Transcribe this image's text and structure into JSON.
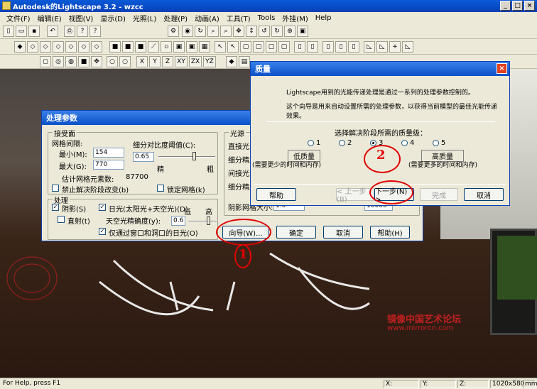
{
  "app": {
    "title": "Autodesk的Lightscape 3.2 - wzcc"
  },
  "menu": [
    "文件(F)",
    "编辑(E)",
    "视图(V)",
    "显示(D)",
    "光照(L)",
    "处理(P)",
    "动画(A)",
    "工具(T)",
    "Tools",
    "外挂(M)",
    "Help"
  ],
  "status": {
    "help": "For Help, press F1",
    "x": "X:",
    "y": "Y:",
    "z": "Z:",
    "size": "1020x580",
    "unit": "mm"
  },
  "toolbar3": {
    "x": "X",
    "y": "Y",
    "z": "Z",
    "xy": "XY",
    "zx": "ZX",
    "yz": "YZ"
  },
  "proc": {
    "title": "处理参数",
    "receiver_group": "接受面",
    "mesh_spacing": "网格间隔:",
    "min_label": "最小(M):",
    "min_value": "154",
    "max_label": "最大(G):",
    "max_value": "770",
    "contrast_label": "细分对比度阈值(C):",
    "contrast_value": "0.65",
    "fine": "精",
    "coarse": "粗",
    "est_label": "估计网格元素数:",
    "est_value": "87700",
    "disable_sub": "禁止解决阶段改变(b)",
    "lock_mesh": "锁定网格(k)",
    "process_group": "处理",
    "shadow": "阴影(S)",
    "daylight": "日光(太阳光+天空光)(D)",
    "direct": "直射(t)",
    "sky_acc": "天空光精确度(y):",
    "sky_value": "0.6",
    "low": "低",
    "high": "高",
    "windows_only": "仅通过窗口和洞口的日光(O)",
    "light_group": "光源",
    "light1": "直接光源",
    "light2": "细分精度",
    "light3": "间接光源",
    "light4": "细分精度",
    "shadow_mesh": "阴影网格大小:",
    "shadow_mesh_val": "1.0",
    "extra_val": "10000",
    "wizard_btn": "向导(W)...",
    "ok_btn": "确定",
    "cancel_btn": "取消",
    "help_btn": "帮助(H)"
  },
  "qual": {
    "title": "质量",
    "desc1": "Lightscape用到的光能传递处理是通过一系列的处理参数控制的。",
    "desc2": "这个向导是用来自动设置所需的处理参数，以获得当前模型的最佳光能传递效果。",
    "select": "选择解决阶段所需的质量级：",
    "levels": [
      "1",
      "2",
      "3",
      "4",
      "5"
    ],
    "low_label": "低质量",
    "low_note": "(需要更少的时间和内存)",
    "high_label": "高质量",
    "high_note": "(需要更多的时间和内存)",
    "help_btn": "帮助",
    "back_btn": "< 上一步(B)",
    "next_btn": "下一步(N) >",
    "finish_btn": "完成",
    "cancel_btn": "取消"
  },
  "annotations": {
    "one": "1",
    "two": "2"
  },
  "watermark": {
    "cn": "镜像中国艺术论坛",
    "url": "www.mirrorcn.com"
  },
  "colors": {
    "accent": "#e00000",
    "title": "#0a50c8"
  }
}
